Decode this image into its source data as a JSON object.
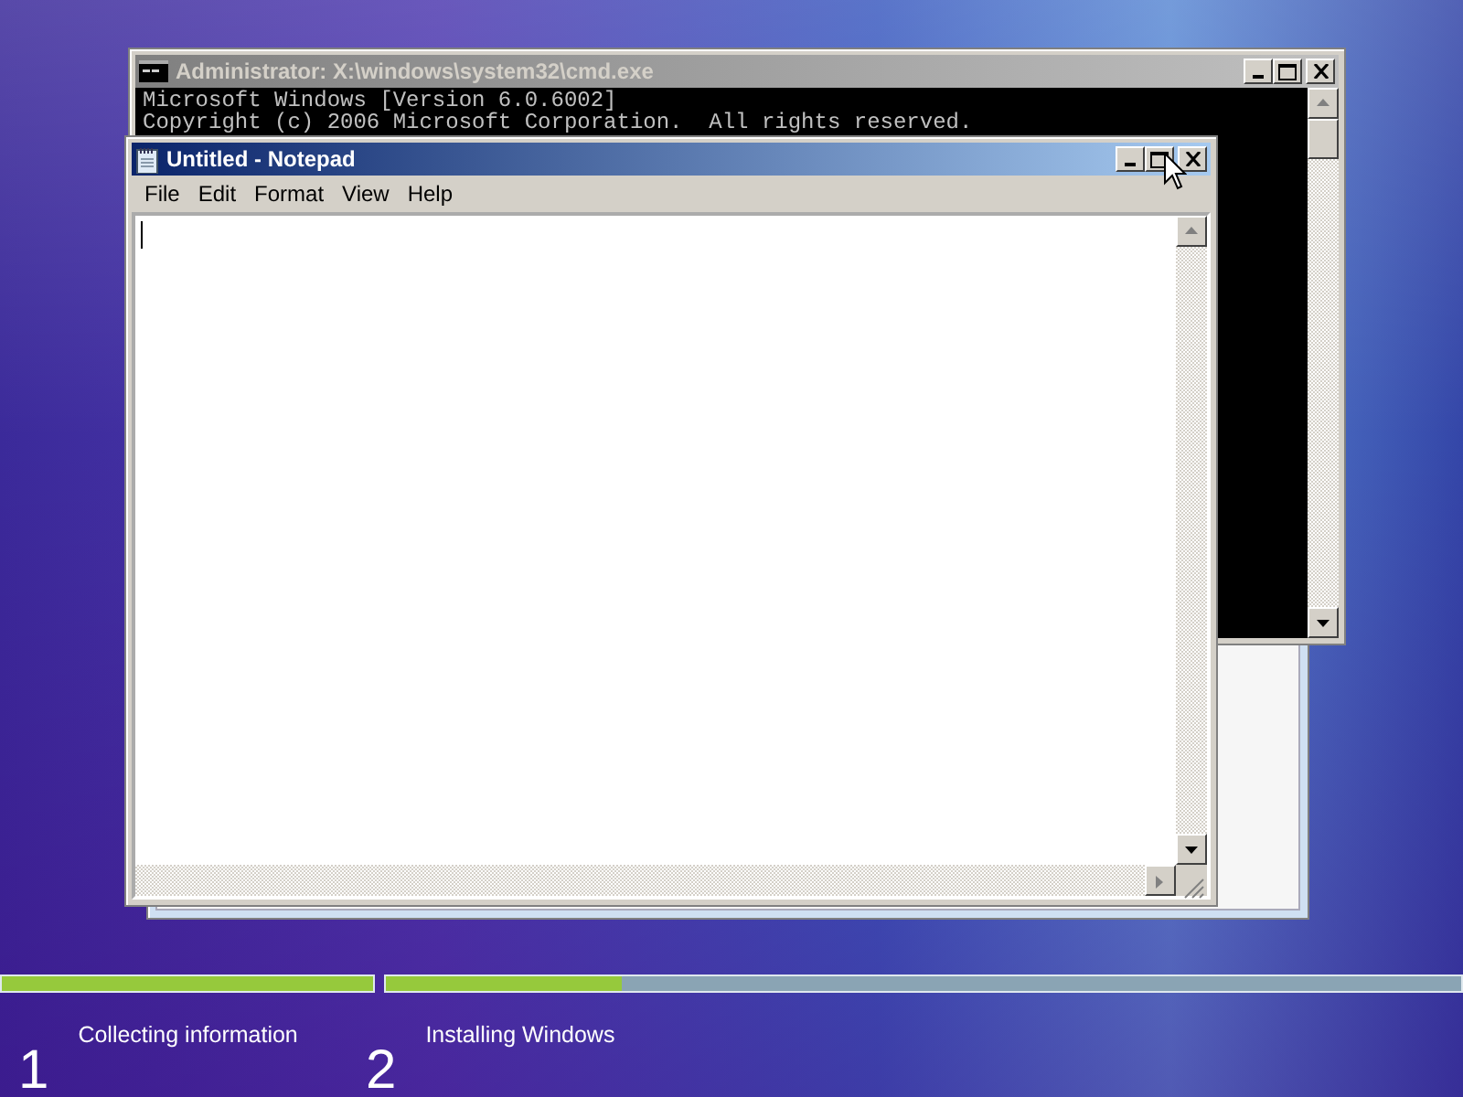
{
  "cmd_window": {
    "title": "Administrator: X:\\windows\\system32\\cmd.exe",
    "lines": [
      "Microsoft Windows [Version 6.0.6002]",
      "Copyright (c) 2006 Microsoft Corporation.  All rights reserved."
    ]
  },
  "notepad": {
    "title": "Untitled - Notepad",
    "menu": [
      "File",
      "Edit",
      "Format",
      "View",
      "Help"
    ]
  },
  "steps": [
    {
      "number": "1",
      "label": "Collecting information",
      "level": 1
    },
    {
      "number": "2",
      "label": "Installing Windows",
      "level": 0.22
    }
  ]
}
